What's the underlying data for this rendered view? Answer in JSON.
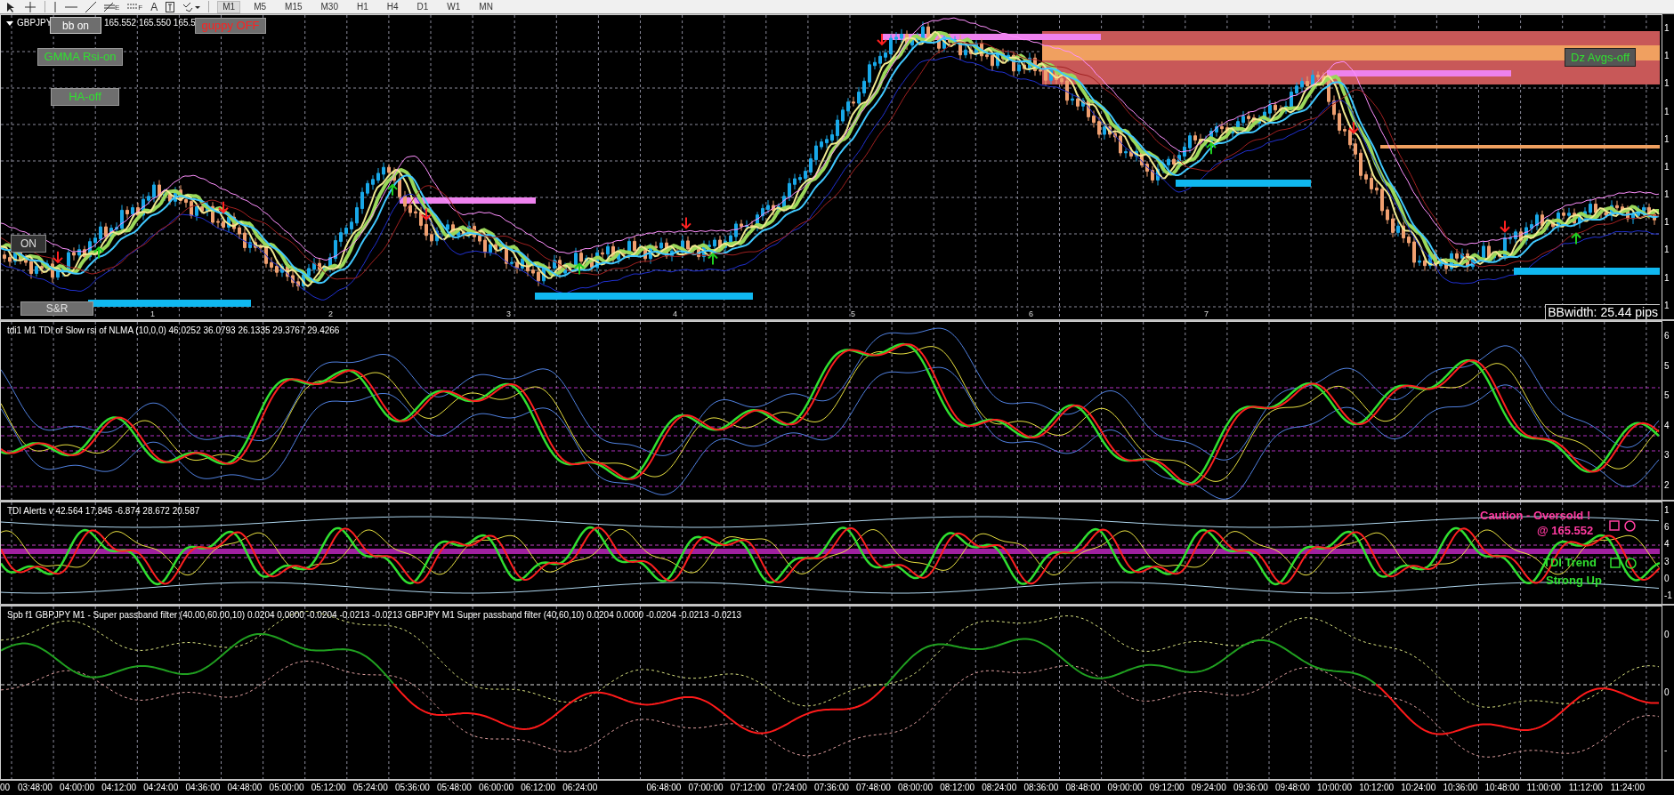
{
  "toolbar": {
    "text_tool": "A",
    "fibo_mark": "E",
    "fibo_fan_mark": "F",
    "timeframes": [
      {
        "label": "M1",
        "selected": true
      },
      {
        "label": "M5",
        "selected": false
      },
      {
        "label": "M15",
        "selected": false
      },
      {
        "label": "M30",
        "selected": false
      },
      {
        "label": "H1",
        "selected": false
      },
      {
        "label": "H4",
        "selected": false
      },
      {
        "label": "D1",
        "selected": false
      },
      {
        "label": "W1",
        "selected": false
      },
      {
        "label": "MN",
        "selected": false
      }
    ]
  },
  "main_chart": {
    "symbol": "GBPJPY",
    "quote": "165.552 165.550 165.5",
    "buttons": [
      {
        "label": "bb on"
      },
      {
        "label": "guppy OFF"
      },
      {
        "label": "GMMA Rsi-on"
      },
      {
        "label": "HA-off"
      },
      {
        "label": "ON"
      },
      {
        "label": "S&R"
      },
      {
        "label": "Dz Avgs-off"
      }
    ],
    "day_marks": [
      "1",
      "2",
      "3",
      "4",
      "5",
      "6",
      "7"
    ],
    "bb_width": "BBwidth: 25.44 pips",
    "axis_labels": [
      "1",
      "1",
      "1",
      "1",
      "1",
      "1",
      "1",
      "1",
      "1",
      "1",
      "1"
    ]
  },
  "tdi_panel": {
    "title": "tdi1 M1 TDI of Slow rsi of NLMA (10,0,0) 46.0252 36.0793 26.1335 29.3767 29.4266",
    "axis_labels": [
      "6",
      "5",
      "5",
      "4",
      "3",
      "2"
    ]
  },
  "alerts_panel": {
    "title": "TDI Alerts v 42.564 17.845 -6.874 28.672 20.587",
    "caution": "Caution - Oversold !",
    "price": "@ 165.552",
    "trend_label": "TDI Trend",
    "trend_value": "Strong Up",
    "axis_labels": [
      "1",
      "6",
      "4",
      "3",
      "0",
      "-1"
    ]
  },
  "spb_panel": {
    "title": "Spb f1 GBPJPY M1 - Super passband filter (40.00,60.00,10) 0.0204 0.0000 -0.0204 -0.0213 -0.0213  GBPJPY M1 Super passband filter (40,60,10) 0.0204 0.0000 -0.0204 -0.0213 -0.0213",
    "axis_labels": [
      "0",
      "0",
      "-"
    ]
  },
  "time_axis": {
    "labels": [
      "00",
      "03:48:00",
      "04:00:00",
      "04:12:00",
      "04:24:00",
      "04:36:00",
      "04:48:00",
      "05:00:00",
      "05:12:00",
      "05:24:00",
      "05:36:00",
      "05:48:00",
      "06:00:00",
      "06:12:00",
      "06:24:00",
      "06:48:00",
      "07:00:00",
      "07:12:00",
      "07:24:00",
      "07:36:00",
      "07:48:00",
      "08:00:00",
      "08:12:00",
      "08:24:00",
      "08:36:00",
      "08:48:00",
      "09:00:00",
      "09:12:00",
      "09:24:00",
      "09:36:00",
      "09:48:00",
      "10:00:00",
      "10:12:00",
      "10:24:00",
      "10:36:00",
      "10:48:00",
      "11:00:00",
      "11:12:00",
      "11:24:00"
    ]
  }
}
